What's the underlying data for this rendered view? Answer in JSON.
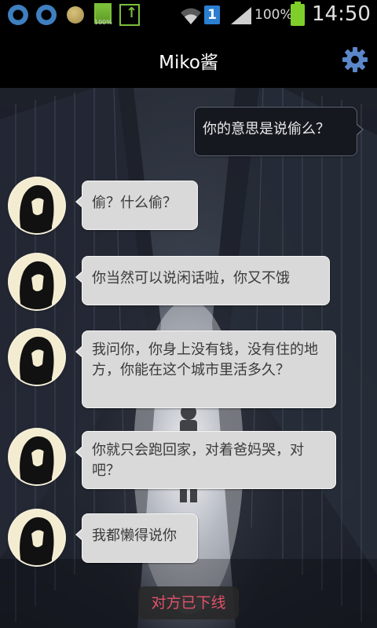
{
  "status_bar": {
    "small_battery_label": "100%",
    "sim_slot": "1",
    "battery_percent": "100%",
    "time": "14:50"
  },
  "header": {
    "title": "Miko酱",
    "settings_icon": "gear-icon"
  },
  "messages": [
    {
      "side": "out",
      "text": "你的意思是说偷么？"
    },
    {
      "side": "in",
      "text": "偷？什么偷？"
    },
    {
      "side": "in",
      "text": "你当然可以说闲话啦，你又不饿"
    },
    {
      "side": "in",
      "text": "我问你，你身上没有钱，没有住的地方，你能在这个城市里活多久？"
    },
    {
      "side": "in",
      "text": "你就只会跑回家，对着爸妈哭，对吧？"
    },
    {
      "side": "in",
      "text": "我都懒得说你"
    }
  ],
  "footer": {
    "status_label": "对方已下线"
  },
  "colors": {
    "accent": "#e2526a",
    "incoming_bubble": "#d9d9d9",
    "outgoing_bubble": "#15181f",
    "gear": "#5b87c8"
  }
}
